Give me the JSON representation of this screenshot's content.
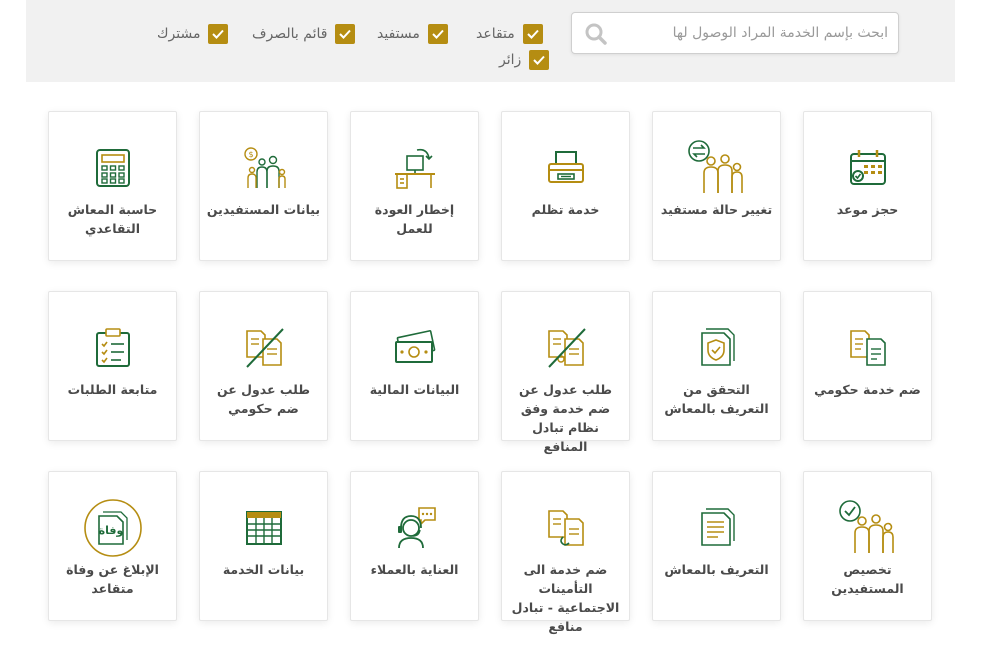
{
  "search": {
    "placeholder": "ابحث بإسم الخدمة المراد الوصول لها",
    "value": ""
  },
  "filters": [
    {
      "label": "متقاعد",
      "checked": true
    },
    {
      "label": "مستفيد",
      "checked": true
    },
    {
      "label": "قائم بالصرف",
      "checked": true
    },
    {
      "label": "مشترك",
      "checked": true
    },
    {
      "label": "زائر",
      "checked": true
    }
  ],
  "services": [
    {
      "label": "حجز موعد",
      "icon": "calendar-icon"
    },
    {
      "label": "تغيير حالة مستفيد",
      "icon": "family-swap-icon"
    },
    {
      "label": "خدمة تظلم",
      "icon": "printer-icon"
    },
    {
      "label": "إخطار العودة للعمل",
      "icon": "office-desk-icon"
    },
    {
      "label": "بيانات المستفيدين",
      "icon": "family-icon"
    },
    {
      "label": "حاسبة المعاش التقاعدي",
      "icon": "calculator-icon"
    },
    {
      "label": "ضم خدمة حكومي",
      "icon": "documents-icon"
    },
    {
      "label": "التحقق من التعريف بالمعاش",
      "icon": "shield-document-icon"
    },
    {
      "label": "طلب عدول عن ضم خدمة وفق نظام تبادل المنافع",
      "icon": "documents-crossed-icon"
    },
    {
      "label": "البيانات المالية",
      "icon": "money-icon"
    },
    {
      "label": "طلب عدول عن ضم حكومي",
      "icon": "documents-crossed-icon"
    },
    {
      "label": "متابعة الطلبات",
      "icon": "clipboard-icon"
    },
    {
      "label": "تخصيص المستفيدين",
      "icon": "family-check-icon"
    },
    {
      "label": "التعريف بالمعاش",
      "icon": "certificate-icon"
    },
    {
      "label": "ضم خدمة الى التأمينات الاجتماعية - تبادل منافع",
      "icon": "documents-link-icon"
    },
    {
      "label": "العناية بالعملاء",
      "icon": "customer-support-icon"
    },
    {
      "label": "بيانات الخدمة",
      "icon": "spreadsheet-icon"
    },
    {
      "label": "الإبلاغ عن وفاة متقاعد",
      "icon": "death-report-icon"
    }
  ],
  "colors": {
    "green": "#1f6b3a",
    "gold": "#b58d12",
    "filter_bg": "#f1f1f1"
  }
}
